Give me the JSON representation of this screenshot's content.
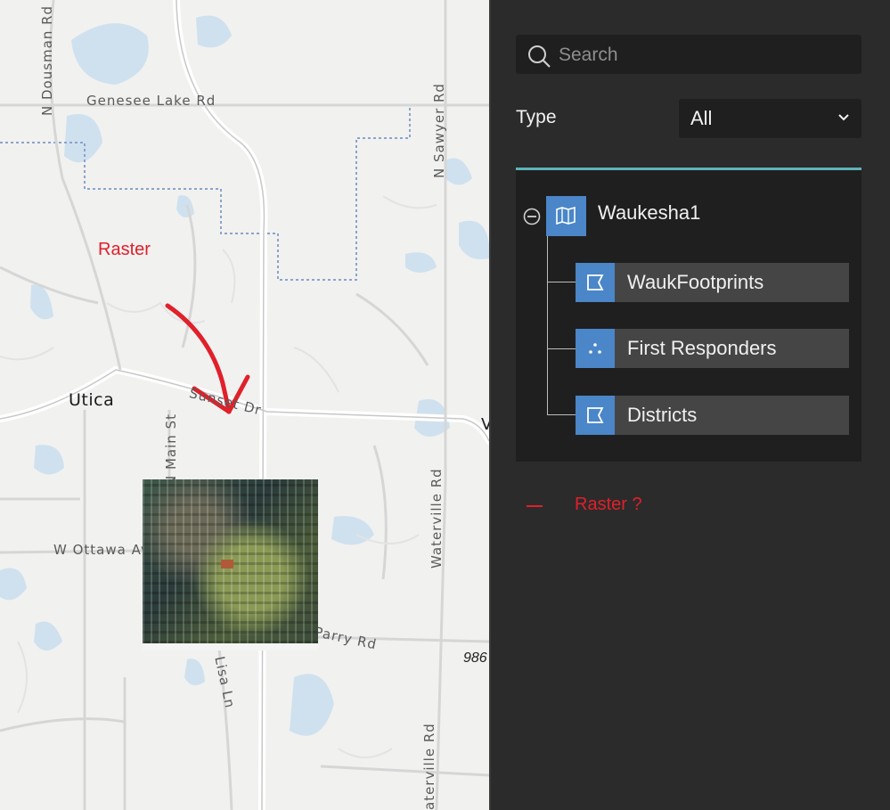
{
  "map": {
    "roads": {
      "genesee": "Genesee Lake Rd",
      "dousman": "N Dousman Rd",
      "sawyer": "N Sawyer Rd",
      "sunset": "Sunset Dr",
      "main": "N Main St",
      "ottawa": "W Ottawa Ave",
      "waterville1": "Waterville Rd",
      "waterville2": "aterville Rd",
      "parry": "Parry Rd",
      "lisa": "Lisa Ln"
    },
    "town": "Utica",
    "partial_label": "986",
    "edge_label": "V",
    "annotation": "Raster"
  },
  "panel": {
    "search_placeholder": "Search",
    "type_label": "Type",
    "type_value": "All",
    "root": {
      "label": "Waukesha1",
      "icon": "map-icon"
    },
    "layers": [
      {
        "label": "WaukFootprints",
        "icon": "polygon-icon"
      },
      {
        "label": "First Responders",
        "icon": "points-icon"
      },
      {
        "label": "Districts",
        "icon": "polygon-icon"
      }
    ],
    "missing": {
      "label": "Raster ?"
    }
  },
  "colors": {
    "accent": "#5db3b8",
    "layer_icon": "#4a86c8",
    "annotation": "#e0202a"
  }
}
